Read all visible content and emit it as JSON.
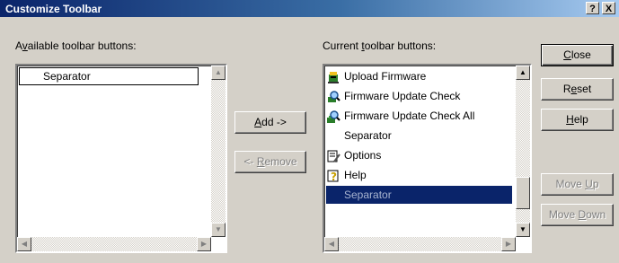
{
  "window": {
    "title": "Customize Toolbar",
    "help_glyph": "?",
    "close_glyph": "X"
  },
  "available": {
    "label_pre": "A",
    "label_ul": "v",
    "label_post": "ailable toolbar buttons:",
    "items": [
      {
        "label": "Separator"
      }
    ]
  },
  "current": {
    "label_pre": "Current ",
    "label_ul": "t",
    "label_post": "oolbar buttons:",
    "items": [
      {
        "label": "Upload Firmware",
        "icon": "upload-firmware-icon"
      },
      {
        "label": "Firmware Update Check",
        "icon": "firmware-update-check-icon"
      },
      {
        "label": "Firmware Update Check All",
        "icon": "firmware-update-check-all-icon"
      },
      {
        "label": "Separator",
        "icon": ""
      },
      {
        "label": "Options",
        "icon": "options-icon"
      },
      {
        "label": "Help",
        "icon": "help-icon"
      },
      {
        "label": "Separator",
        "icon": ""
      }
    ],
    "selected_index": 6
  },
  "buttons": {
    "add": {
      "ul": "A",
      "rest": "dd ->"
    },
    "remove": {
      "pre": "<- ",
      "ul": "R",
      "rest": "emove"
    },
    "close": {
      "ul": "C",
      "rest": "lose"
    },
    "reset": {
      "pre": "R",
      "ul": "e",
      "rest": "set"
    },
    "help": {
      "ul": "H",
      "rest": "elp"
    },
    "move_up": {
      "pre": "Move ",
      "ul": "U",
      "rest": "p"
    },
    "move_down": {
      "pre": "Move ",
      "ul": "D",
      "rest": "own"
    }
  },
  "scroll": {
    "up_glyph": "▲",
    "down_glyph": "▼",
    "left_glyph": "◀",
    "right_glyph": "▶"
  },
  "colors": {
    "title_gradient_start": "#0a246a",
    "selection": "#0a246a",
    "face": "#d4d0c8"
  }
}
